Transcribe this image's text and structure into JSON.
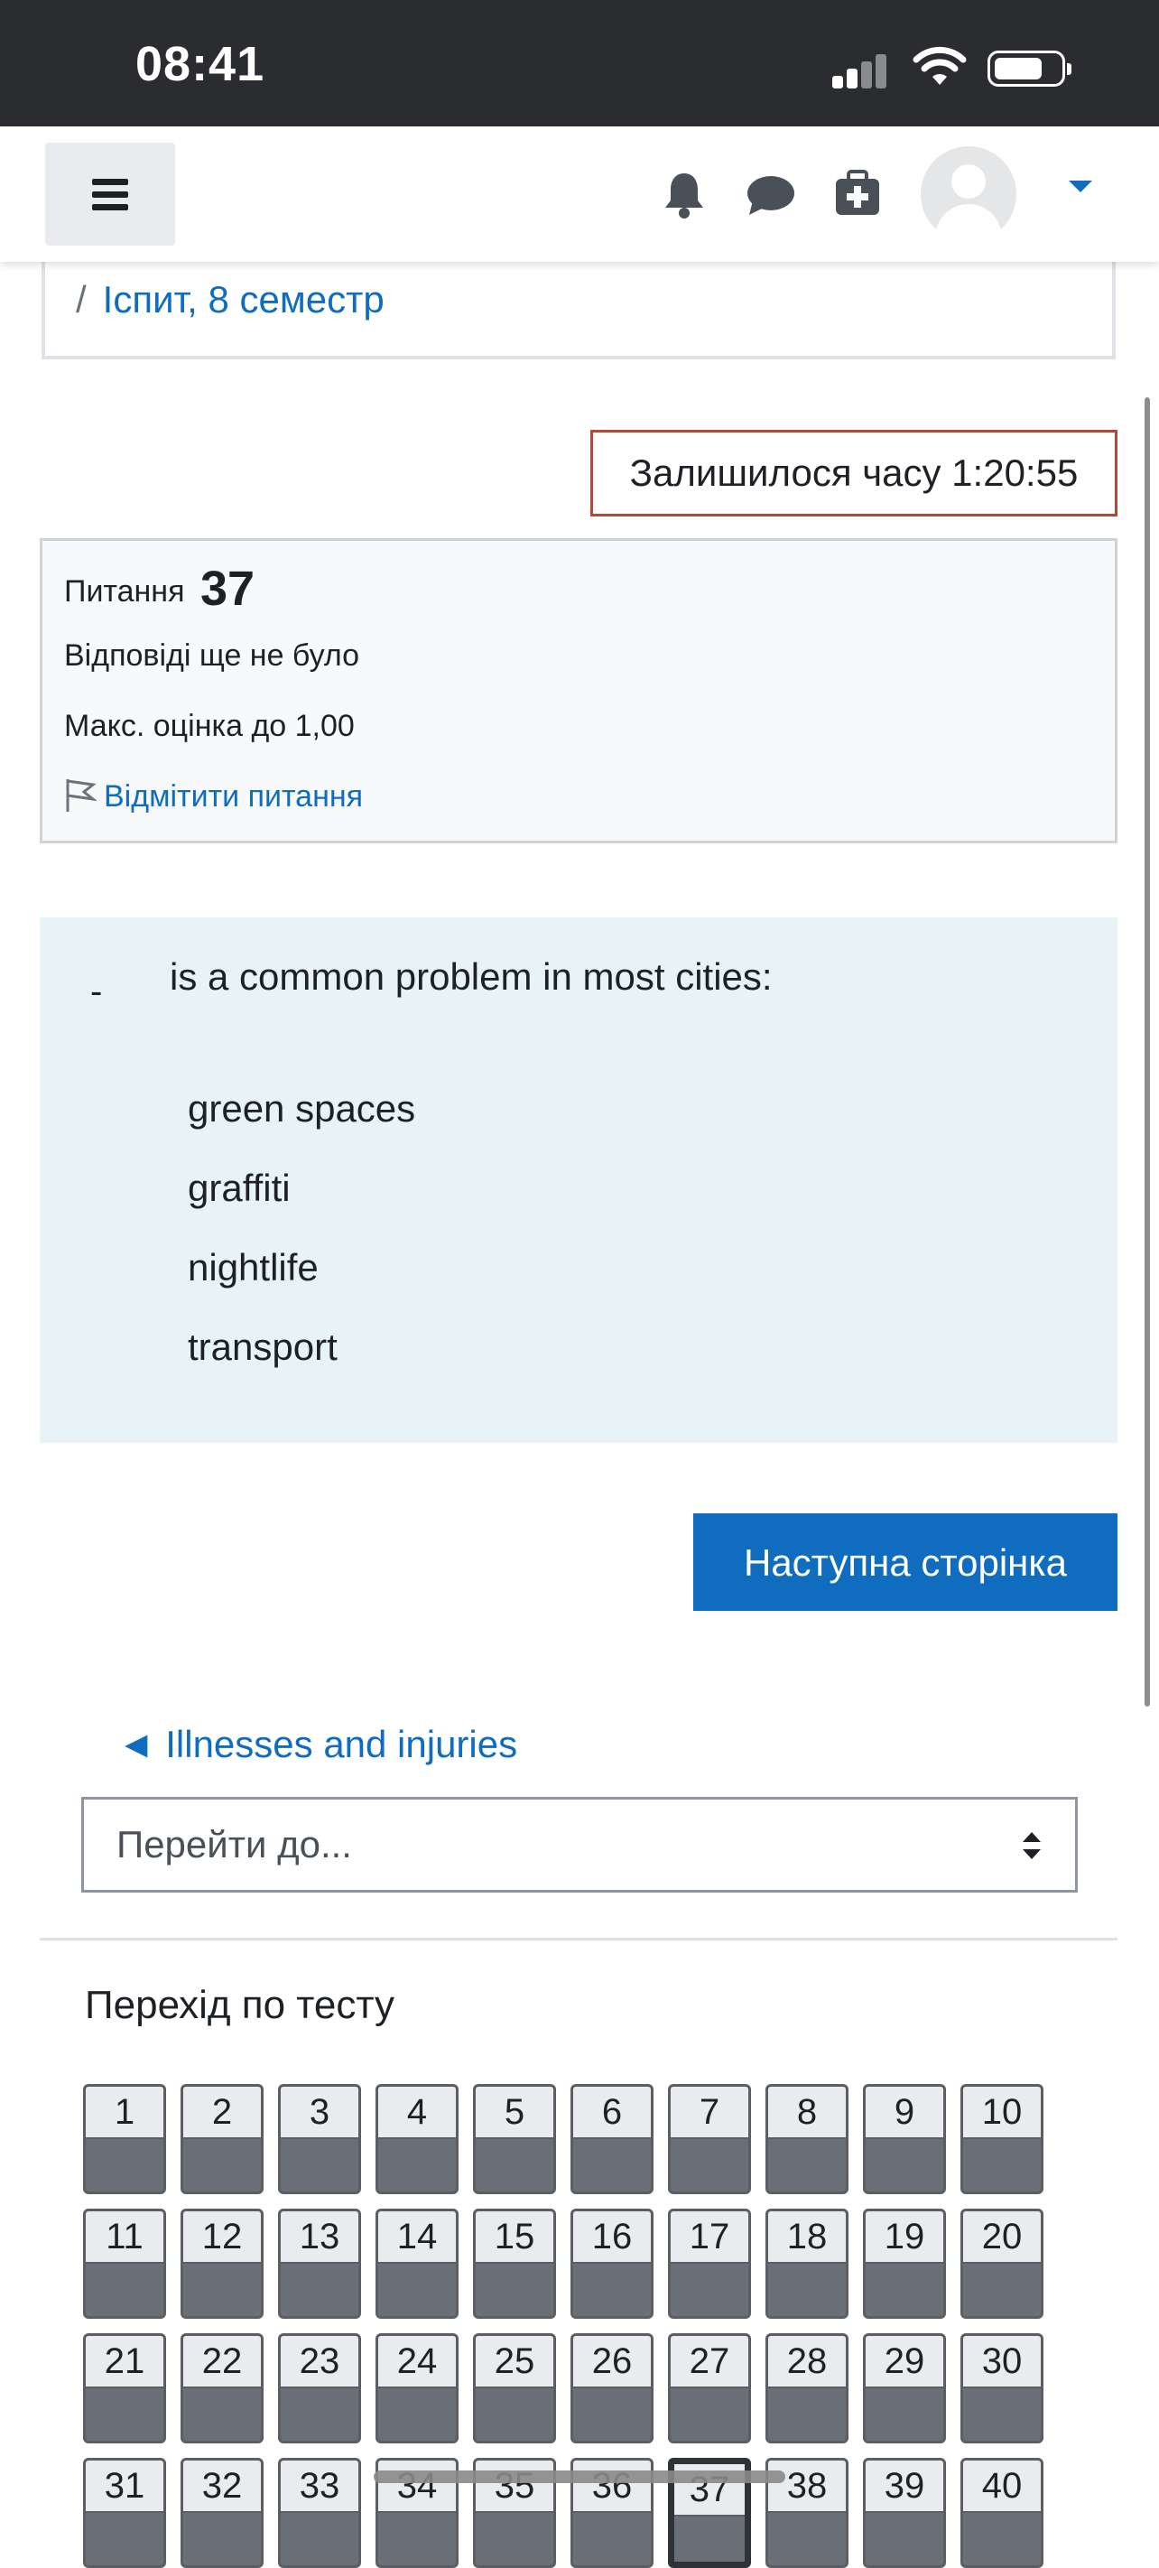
{
  "status_bar": {
    "time": "08:41"
  },
  "navbar": {
    "menu_icon": "hamburger-icon",
    "icons": [
      "bell-icon",
      "chat-icon",
      "first-aid-icon",
      "user-avatar",
      "chevron-down-icon"
    ],
    "accent": "#0f6cbf"
  },
  "breadcrumb": {
    "separator": "/",
    "current": "Іспит, 8 семестр"
  },
  "timer": {
    "text": "Залишилося часу 1:20:55"
  },
  "question_info": {
    "label": "Питання",
    "number": "37",
    "state": "Відповіді ще не було",
    "grade": "Макс. оцінка до 1,00",
    "flag_label": "Відмітити питання"
  },
  "question": {
    "blank": "-",
    "text": "is a common problem in most cities:",
    "answers": [
      "green spaces",
      "graffiti",
      "nightlife",
      "transport"
    ]
  },
  "next_button": {
    "label": "Наступна сторінка"
  },
  "prev_activity": {
    "label": "◄ Illnesses and injuries"
  },
  "jump_select": {
    "label": "Перейти до..."
  },
  "quiz_navigation": {
    "title": "Перехід по тесту",
    "current": "37",
    "buttons": [
      "1",
      "2",
      "3",
      "4",
      "5",
      "6",
      "7",
      "8",
      "9",
      "10",
      "11",
      "12",
      "13",
      "14",
      "15",
      "16",
      "17",
      "18",
      "19",
      "20",
      "21",
      "22",
      "23",
      "24",
      "25",
      "26",
      "27",
      "28",
      "29",
      "30",
      "31",
      "32",
      "33",
      "34",
      "35",
      "36",
      "37",
      "38",
      "39",
      "40"
    ]
  }
}
